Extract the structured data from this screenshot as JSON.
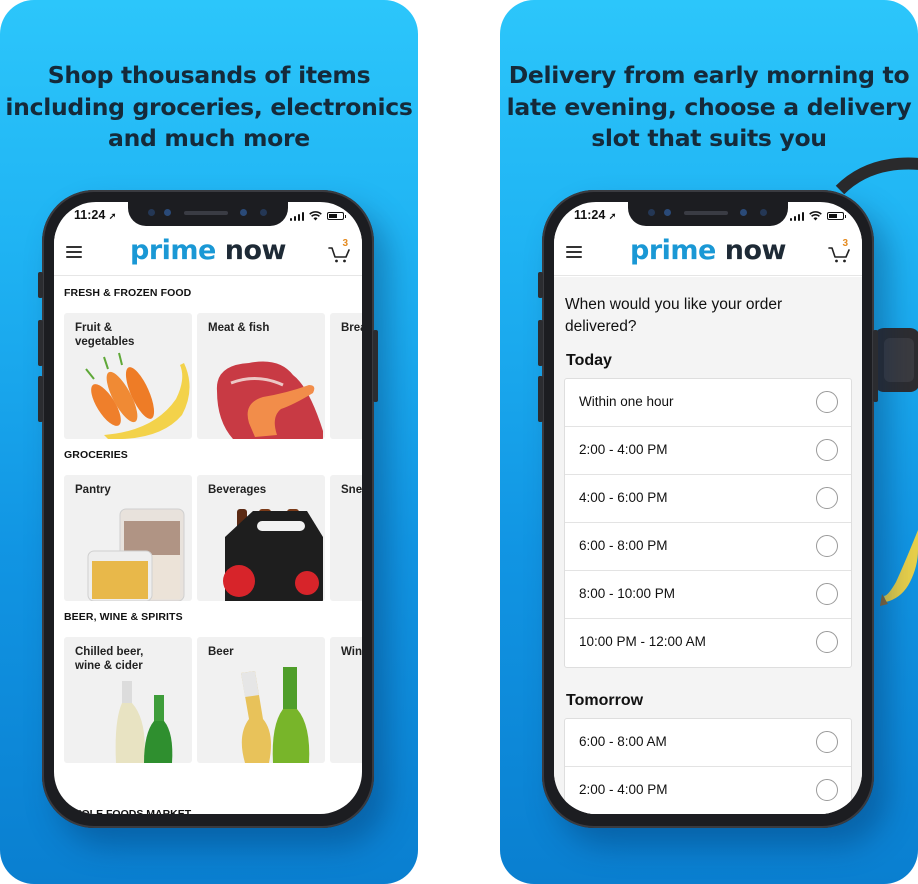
{
  "panels": [
    {
      "headline_lines": [
        "Shop thousands of items",
        "including groceries, electronics",
        "and much more"
      ]
    },
    {
      "headline_lines": [
        "Delivery from early morning to",
        "late evening, choose a delivery",
        "slot that suits you"
      ]
    }
  ],
  "status_bar": {
    "time": "11:24",
    "location_icon": "location-arrow-icon"
  },
  "app_header": {
    "menu_icon": "hamburger-icon",
    "logo_part1": "prime",
    "logo_part2": "now",
    "cart_icon": "cart-icon",
    "cart_count": "3"
  },
  "browse": {
    "sections": [
      {
        "title": "FRESH & FROZEN FOOD",
        "cards": [
          {
            "label": "Fruit & vegetables",
            "image": "carrots-banana"
          },
          {
            "label": "Meat & fish",
            "image": "steak-prawn"
          },
          {
            "label": "Brea",
            "image": ""
          }
        ]
      },
      {
        "title": "GROCERIES",
        "cards": [
          {
            "label": "Pantry",
            "image": "storage-jars"
          },
          {
            "label": "Beverages",
            "image": "cola-pack"
          },
          {
            "label": "Snea",
            "image": ""
          }
        ]
      },
      {
        "title": "BEER, WINE & SPIRITS",
        "cards": [
          {
            "label": "Chilled beer, wine & cider",
            "image": "wine-beer-bottles"
          },
          {
            "label": "Beer",
            "image": "beer-bottles"
          },
          {
            "label": "Win",
            "image": ""
          }
        ]
      }
    ],
    "cut_off_section": "WHOLE FOODS MARKET"
  },
  "delivery": {
    "question": "When would you like your order delivered?",
    "days": [
      {
        "title": "Today",
        "slots": [
          "Within one hour",
          "2:00 - 4:00 PM",
          "4:00 - 6:00 PM",
          "6:00 - 8:00 PM",
          "8:00 - 10:00 PM",
          "10:00 PM - 12:00 AM"
        ]
      },
      {
        "title": "Tomorrow",
        "slots": [
          "6:00 - 8:00 AM",
          "2:00 - 4:00 PM"
        ]
      }
    ]
  },
  "colors": {
    "brand_blue": "#1a98d5",
    "brand_dark": "#1e2a36",
    "cart_badge": "#e48a1f",
    "panel_top": "#2cc6fb",
    "panel_bottom": "#0a7fd0"
  }
}
